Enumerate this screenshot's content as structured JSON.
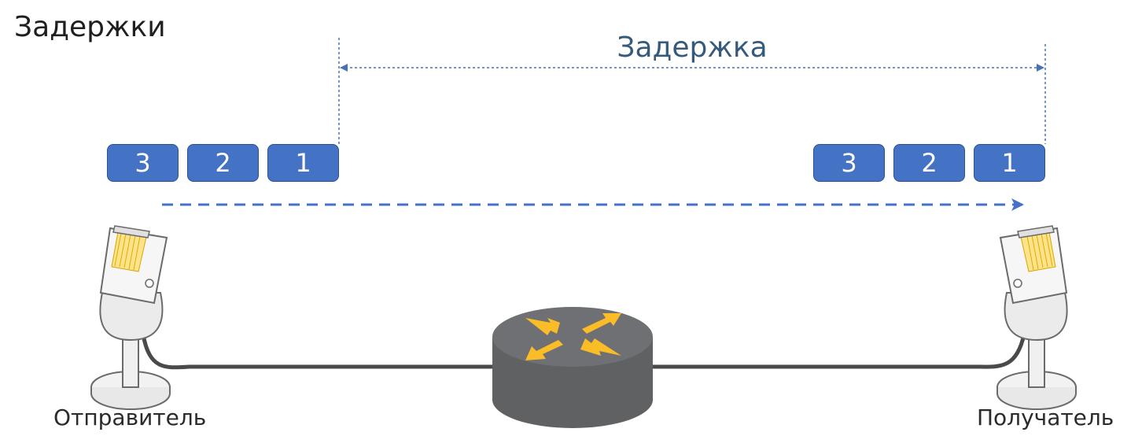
{
  "title": "Задержки",
  "delay_label": "Задержка",
  "sender_packets": [
    "3",
    "2",
    "1"
  ],
  "receiver_packets": [
    "3",
    "2",
    "1"
  ],
  "sender_label": "Отправитель",
  "receiver_label": "Получатель",
  "icons": {
    "sender": "rj45-connector-icon",
    "receiver": "rj45-connector-icon",
    "router": "router-icon"
  },
  "colors": {
    "packet_fill": "#4472c4",
    "packet_border": "#2f528f",
    "arrow": "#4472c4",
    "router_body": "#5f6163",
    "router_arrows": "#fbbd27",
    "cable": "#4a4a4a"
  }
}
